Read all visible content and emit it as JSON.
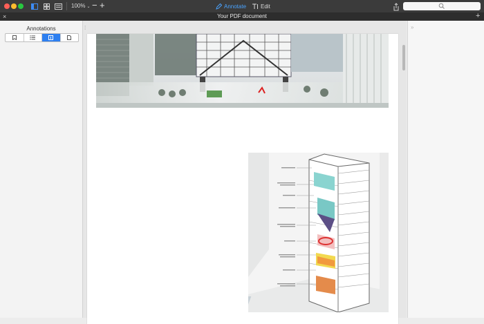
{
  "toolbar": {
    "zoom": "100%",
    "zoom_out": "−",
    "zoom_in": "+",
    "annotate_label": "Annotate",
    "edit_label": "Edit"
  },
  "tab": {
    "title": "Your PDF document",
    "close_glyph": "×",
    "add_glyph": "+"
  },
  "sidebar": {
    "title": "Annotations",
    "segments": [
      {
        "icon": "bookmark-icon",
        "active": false
      },
      {
        "icon": "list-icon",
        "active": false
      },
      {
        "icon": "annotations-icon",
        "active": true
      },
      {
        "icon": "page-icon",
        "active": false
      }
    ]
  },
  "accent_color": "#2d7ff0",
  "document": {
    "figures": [
      {
        "name": "building-rendering-image"
      },
      {
        "name": "tower-section-diagram-image"
      }
    ]
  }
}
